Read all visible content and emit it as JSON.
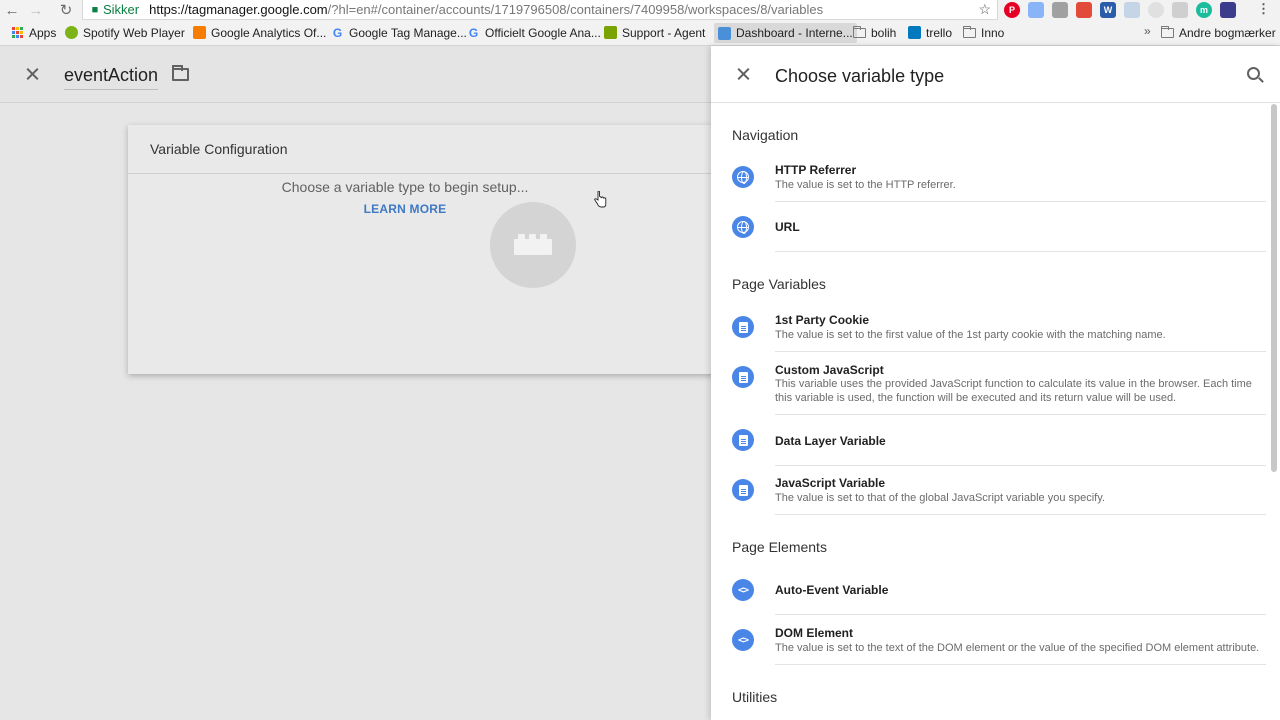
{
  "browser": {
    "secure_label": "Sikker",
    "url_host": "https://tagmanager.google.com",
    "url_rest": "/?hl=en#/container/accounts/1719796508/containers/7409958/workspaces/8/variables",
    "icons": [
      "back-icon",
      "forward-icon",
      "reload-icon",
      "lock-icon",
      "star-icon",
      "menu-icon"
    ],
    "bookmarks": [
      {
        "label": "Apps",
        "icon": "apps-icon"
      },
      {
        "label": "Spotify Web Player",
        "icon": "spotify-icon",
        "color": "#7bb319"
      },
      {
        "label": "Google Analytics Of...",
        "icon": "analytics-icon",
        "color": "#f57c00"
      },
      {
        "label": "Google Tag Manage...",
        "icon": "google-icon"
      },
      {
        "label": "Officielt Google Ana...",
        "icon": "google-icon"
      },
      {
        "label": "Support - Agent",
        "icon": "zendesk-icon",
        "color": "#78a300"
      },
      {
        "label": "Dashboard - Interne...",
        "icon": "dashboard-icon",
        "color": "#4a90d9"
      },
      {
        "label": "bolih",
        "icon": "folder-icon"
      },
      {
        "label": "trello",
        "icon": "trello-icon",
        "color": "#0079bf"
      },
      {
        "label": "Inno",
        "icon": "folder-icon"
      },
      {
        "label": "Andre bogmærker",
        "icon": "folder-icon"
      }
    ],
    "overflow_label": "»"
  },
  "editor": {
    "variable_name": "eventAction",
    "config_title": "Variable Configuration",
    "hint": "Choose a variable type to begin setup...",
    "learn_more": "LEARN MORE"
  },
  "panel": {
    "title": "Choose variable type",
    "sections": [
      {
        "title": "Navigation"
      },
      {
        "title": "Page Variables"
      },
      {
        "title": "Page Elements"
      },
      {
        "title": "Utilities"
      }
    ],
    "items": [
      {
        "name": "HTTP Referrer",
        "desc": "The value is set to the HTTP referrer.",
        "icon": "globe-icon"
      },
      {
        "name": "URL",
        "desc": "",
        "icon": "globe-icon"
      },
      {
        "name": "1st Party Cookie",
        "desc": "The value is set to the first value of the 1st party cookie with the matching name.",
        "icon": "document-icon"
      },
      {
        "name": "Custom JavaScript",
        "desc": "This variable uses the provided JavaScript function to calculate its value in the browser. Each time this variable is used, the function will be executed and its return value will be used.",
        "icon": "document-icon"
      },
      {
        "name": "Data Layer Variable",
        "desc": "",
        "icon": "document-icon"
      },
      {
        "name": "JavaScript Variable",
        "desc": "The value is set to that of the global JavaScript variable you specify.",
        "icon": "document-icon"
      },
      {
        "name": "Auto-Event Variable",
        "desc": "",
        "icon": "code-icon"
      },
      {
        "name": "DOM Element",
        "desc": "The value is set to the text of the DOM element or the value of the specified DOM element attribute.",
        "icon": "code-icon"
      }
    ]
  },
  "colors": {
    "accent": "#4a86e8",
    "link": "#3f79c4",
    "secure": "#0b8043"
  }
}
